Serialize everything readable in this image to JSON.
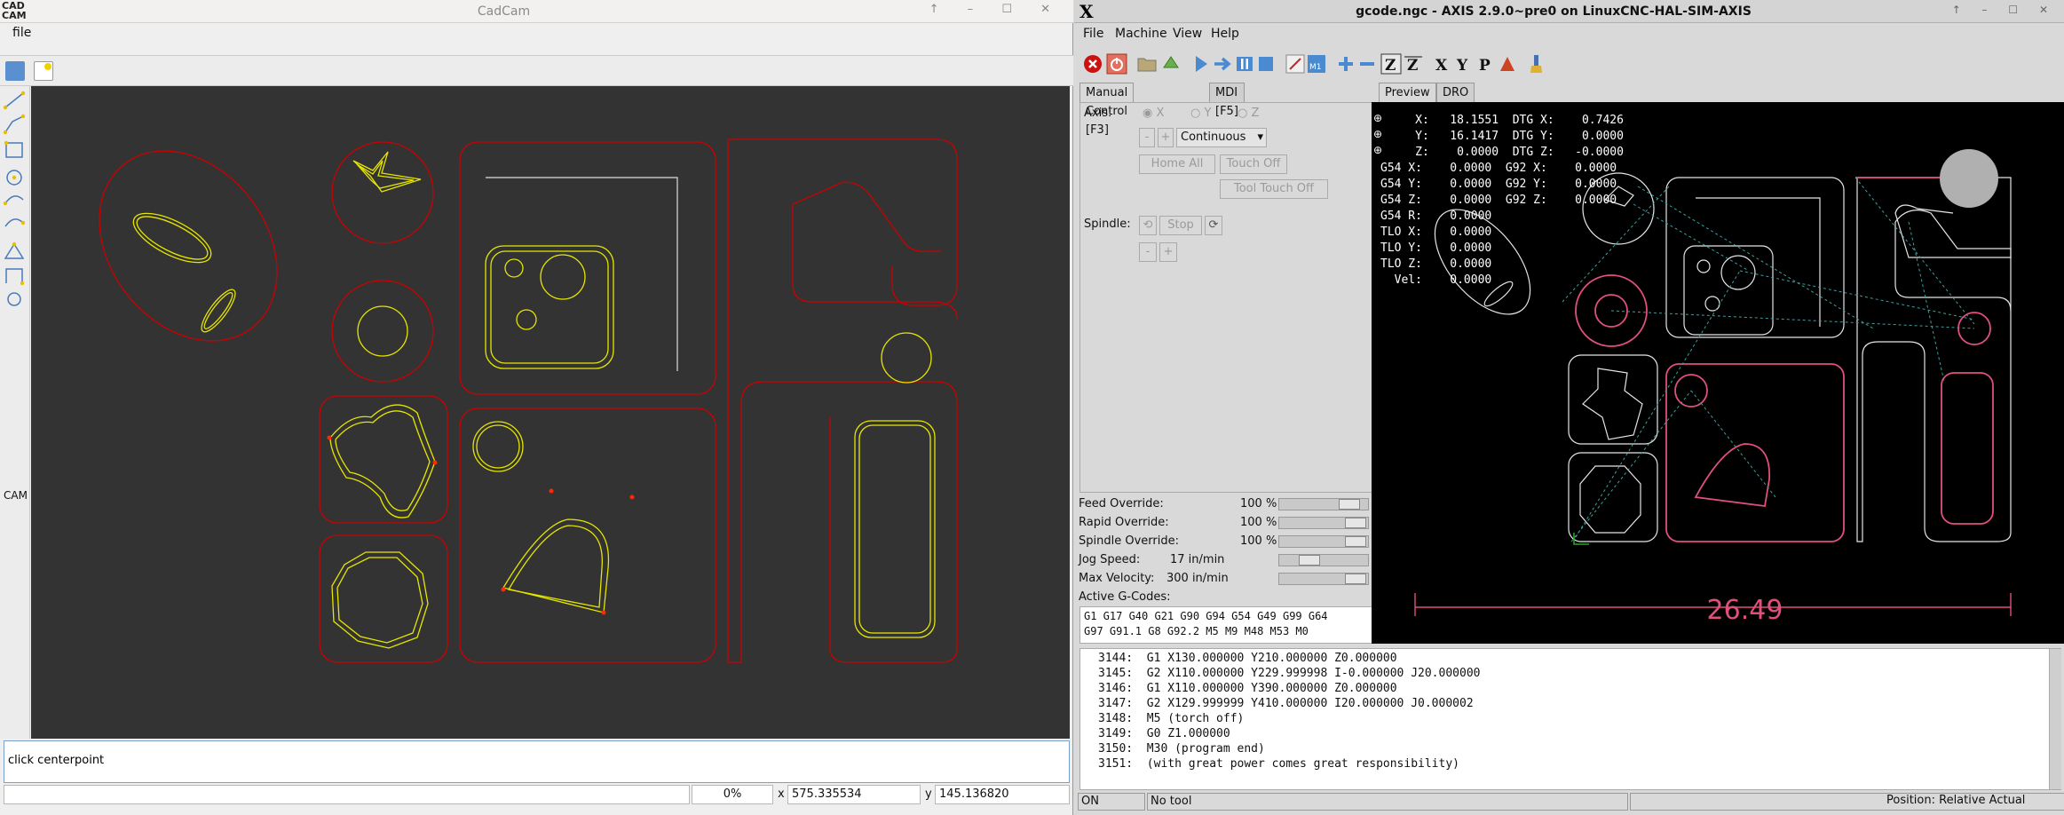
{
  "cadcam": {
    "title": "CadCam",
    "logo_line1": "CAD",
    "logo_line2": "CAM",
    "menu": {
      "file": "file"
    },
    "sidebar_label": "CAM",
    "command_prompt": "click centerpoint",
    "status": {
      "progress": "0%",
      "x_label": "x",
      "x_value": "575.335534",
      "y_label": "y",
      "y_value": "145.136820"
    }
  },
  "axis": {
    "logo": "X",
    "title": "gcode.ngc - AXIS 2.9.0~pre0 on LinuxCNC-HAL-SIM-AXIS",
    "menu": {
      "file": "File",
      "machine": "Machine",
      "view": "View",
      "help": "Help"
    },
    "tabs": {
      "manual": "Manual Control [F3]",
      "mdi": "MDI [F5]",
      "preview": "Preview",
      "dro": "DRO"
    },
    "manual": {
      "axis_label": "Axis:",
      "axis_x": "X",
      "axis_y": "Y",
      "axis_z": "Z",
      "minus": "-",
      "plus": "+",
      "jog_mode": "Continuous",
      "home_all": "Home All",
      "touch_off": "Touch Off",
      "tool_touch_off": "Tool Touch Off",
      "spindle_label": "Spindle:",
      "stop": "Stop"
    },
    "overrides": {
      "feed_label": "Feed Override:",
      "feed_value": "100 %",
      "feed_fraction": 0.9,
      "rapid_label": "Rapid Override:",
      "rapid_value": "100 %",
      "rapid_fraction": 1.0,
      "spindle_label": "Spindle Override:",
      "spindle_value": "100 %",
      "spindle_fraction": 1.0,
      "jog_label": "Jog Speed:",
      "jog_value": "17 in/min",
      "jog_fraction": 0.3,
      "maxvel_label": "Max Velocity:",
      "maxvel_value": "300 in/min",
      "maxvel_fraction": 1.0
    },
    "active_gcodes_label": "Active G-Codes:",
    "active_gcodes": "G1 G17 G40 G21 G90 G94 G54 G49 G99 G64\nG97 G91.1 G8 G92.2 M5 M9 M48 M53 M0",
    "dro_lines": [
      "     X:   18.1551  DTG X:    0.7426",
      "     Y:   16.1417  DTG Y:    0.0000",
      "     Z:    0.0000  DTG Z:   -0.0000",
      "G54 X:    0.0000  G92 X:    0.0000",
      "G54 Y:    0.0000  G92 Y:    0.0000",
      "G54 Z:    0.0000  G92 Z:    0.0000",
      "G54 R:    0.0000",
      "TLO X:    0.0000",
      "TLO Y:    0.0000",
      "TLO Z:    0.0000",
      "  Vel:    0.0000"
    ],
    "preview_dimension": "26.49",
    "code_lines": [
      "3144:  G1 X130.000000 Y210.000000 Z0.000000",
      "3145:  G2 X110.000000 Y229.999998 I-0.000000 J20.000000",
      "3146:  G1 X110.000000 Y390.000000 Z0.000000",
      "3147:  G2 X129.999999 Y410.000000 I20.000000 J0.000002",
      "3148:  M5 (torch off)",
      "3149:  G0 Z1.000000",
      "3150:  M30 (program end)",
      "3151:  (with great power comes great responsibility)"
    ],
    "status": {
      "machine": "ON",
      "tool": "No tool",
      "position": "Position: Relative Actual"
    }
  },
  "colors": {
    "cad_bg": "#333333",
    "cut_red": "#cc0000",
    "part_yellow": "#e6e600",
    "preview_pink": "#e0507a"
  }
}
